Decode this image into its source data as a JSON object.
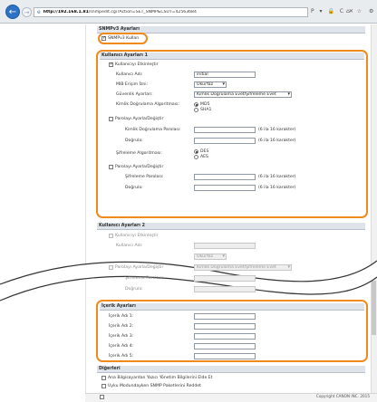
{
  "browser": {
    "url_host": "http://192.168.1.81",
    "url_rest": "/snmpedit.cgi?Action=SET_SNMP&CSUT=42563684",
    "addr_icons": "P ▾ 🔒 C ✕",
    "win_icons": "⌂ ☆ ⚙"
  },
  "snmpv3": {
    "header": "SNMPv3 Ayarları",
    "use_label": "SNMPv3 Kullan"
  },
  "user1": {
    "header": "Kullanıcı Ayarları 1",
    "enable_label": "Kullanıcıyı Etkinleştir",
    "username_label": "Kullanıcı Adı:",
    "username_value": "initial",
    "access_label": "MIB Erişim İzni:",
    "access_value": "Oku/Yaz",
    "security_label": "Güvenlik Ayarları:",
    "security_value": "Kimlik Doğrulama Evet/Şifreleme Evet",
    "auth_algo_label": "Kimlik Doğrulama Algoritması:",
    "auth_opt1": "MD5",
    "auth_opt2": "SHA1",
    "pw_set_label": "Parolayı Ayarla/Değiştir",
    "auth_pw_label": "Kimlik Doğrulama Parolası:",
    "auth_pw_hint": "(6 ila 16 karakter)",
    "confirm_label": "Doğrula:",
    "confirm_hint": "(6 ila 16 karakter)",
    "enc_algo_label": "Şifreleme Algoritması:",
    "enc_opt1": "DES",
    "enc_opt2": "AES",
    "pw_set2_label": "Parolayı Ayarla/Değiştir",
    "enc_pw_label": "Şifreleme Parolası:",
    "enc_pw_hint": "(6 ila 16 karakter)",
    "confirm2_label": "Doğrula:",
    "confirm2_hint": "(6 ila 16 karakter)"
  },
  "user2": {
    "header": "Kullanıcı Ayarları 2",
    "enable_label": "Kullanıcıyı Etkinleştir",
    "username_label": "Kullanıcı Adı:",
    "access_value": "Oku/Yaz",
    "pw_set_label": "Parolayı Ayarla/Değiştir",
    "security_value": "Kimlik Doğrulama Evet/Şifreleme Evet",
    "enc_pw_label": "Şifreleme Parolası:",
    "confirm_label": "Doğrula:"
  },
  "context": {
    "header": "İçerik Ayarları",
    "items": [
      "İçerik Adı 1:",
      "İçerik Adı 2:",
      "İçerik Adı 3:",
      "İçerik Adı 4:",
      "İçerik Adı 5:"
    ]
  },
  "others": {
    "header": "Diğerleri",
    "opt1": "Ana Bilgisayardan Yazıcı Yönetim Bilgilerini Elde Et",
    "opt2": "Uyku Modundayken SNMP Paketlerini Reddet"
  },
  "footer": {
    "copyright": "Copyright CANON INC. 2015"
  },
  "colors": {
    "highlight": "#f08a1c",
    "back_button": "#2f72c4"
  }
}
